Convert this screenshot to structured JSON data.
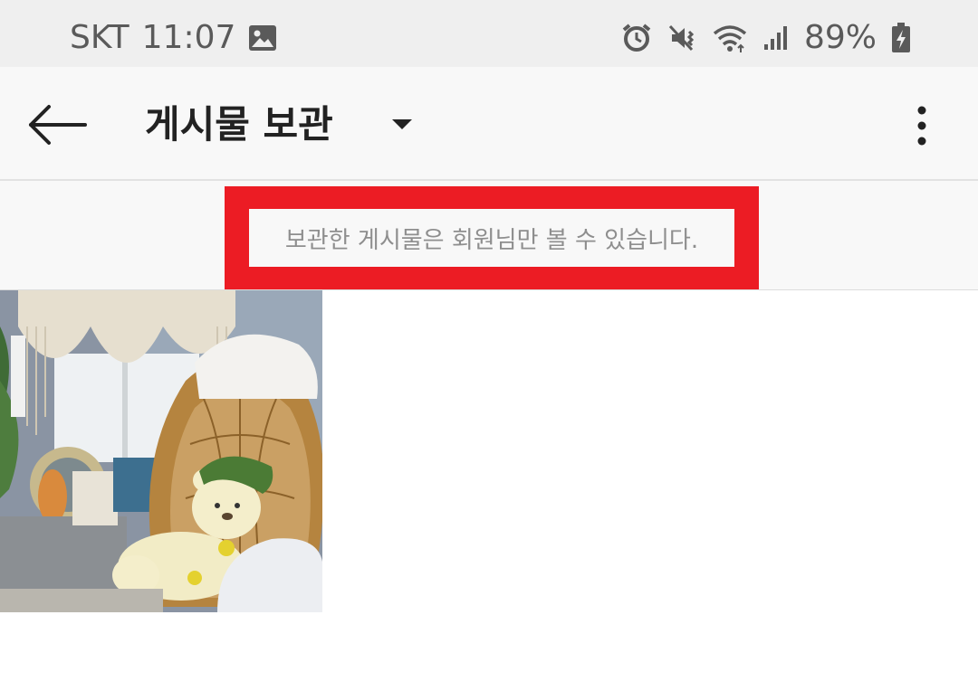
{
  "status_bar": {
    "carrier": "SKT",
    "time": "11:07",
    "battery_percent": "89%",
    "icons": [
      "gallery-icon",
      "alarm-icon",
      "mute-icon",
      "wifi-icon",
      "signal-icon",
      "battery-charging-icon"
    ]
  },
  "app_bar": {
    "title": "게시물 보관",
    "icons": [
      "back-arrow-icon",
      "dropdown-caret-icon",
      "more-vert-icon"
    ]
  },
  "notice": {
    "text": "보관한 게시물은 회원님만 볼 수 있습니다.",
    "highlight_color": "#ec1c24"
  },
  "posts": [
    {
      "name": "archived-post-1"
    }
  ],
  "colors": {
    "status_bar_bg": "#efefef",
    "app_bar_bg": "#f8f8f8",
    "notice_text": "#8e8e8e"
  }
}
